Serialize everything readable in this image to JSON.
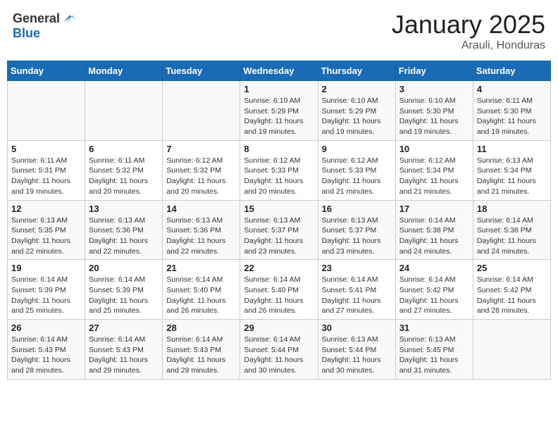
{
  "header": {
    "logo_general": "General",
    "logo_blue": "Blue",
    "month": "January 2025",
    "location": "Arauli, Honduras"
  },
  "weekdays": [
    "Sunday",
    "Monday",
    "Tuesday",
    "Wednesday",
    "Thursday",
    "Friday",
    "Saturday"
  ],
  "weeks": [
    [
      {
        "day": "",
        "sunrise": "",
        "sunset": "",
        "daylight": ""
      },
      {
        "day": "",
        "sunrise": "",
        "sunset": "",
        "daylight": ""
      },
      {
        "day": "",
        "sunrise": "",
        "sunset": "",
        "daylight": ""
      },
      {
        "day": "1",
        "sunrise": "Sunrise: 6:10 AM",
        "sunset": "Sunset: 5:29 PM",
        "daylight": "Daylight: 11 hours and 19 minutes."
      },
      {
        "day": "2",
        "sunrise": "Sunrise: 6:10 AM",
        "sunset": "Sunset: 5:29 PM",
        "daylight": "Daylight: 11 hours and 19 minutes."
      },
      {
        "day": "3",
        "sunrise": "Sunrise: 6:10 AM",
        "sunset": "Sunset: 5:30 PM",
        "daylight": "Daylight: 11 hours and 19 minutes."
      },
      {
        "day": "4",
        "sunrise": "Sunrise: 6:11 AM",
        "sunset": "Sunset: 5:30 PM",
        "daylight": "Daylight: 11 hours and 19 minutes."
      }
    ],
    [
      {
        "day": "5",
        "sunrise": "Sunrise: 6:11 AM",
        "sunset": "Sunset: 5:31 PM",
        "daylight": "Daylight: 11 hours and 19 minutes."
      },
      {
        "day": "6",
        "sunrise": "Sunrise: 6:11 AM",
        "sunset": "Sunset: 5:32 PM",
        "daylight": "Daylight: 11 hours and 20 minutes."
      },
      {
        "day": "7",
        "sunrise": "Sunrise: 6:12 AM",
        "sunset": "Sunset: 5:32 PM",
        "daylight": "Daylight: 11 hours and 20 minutes."
      },
      {
        "day": "8",
        "sunrise": "Sunrise: 6:12 AM",
        "sunset": "Sunset: 5:33 PM",
        "daylight": "Daylight: 11 hours and 20 minutes."
      },
      {
        "day": "9",
        "sunrise": "Sunrise: 6:12 AM",
        "sunset": "Sunset: 5:33 PM",
        "daylight": "Daylight: 11 hours and 21 minutes."
      },
      {
        "day": "10",
        "sunrise": "Sunrise: 6:12 AM",
        "sunset": "Sunset: 5:34 PM",
        "daylight": "Daylight: 11 hours and 21 minutes."
      },
      {
        "day": "11",
        "sunrise": "Sunrise: 6:13 AM",
        "sunset": "Sunset: 5:34 PM",
        "daylight": "Daylight: 11 hours and 21 minutes."
      }
    ],
    [
      {
        "day": "12",
        "sunrise": "Sunrise: 6:13 AM",
        "sunset": "Sunset: 5:35 PM",
        "daylight": "Daylight: 11 hours and 22 minutes."
      },
      {
        "day": "13",
        "sunrise": "Sunrise: 6:13 AM",
        "sunset": "Sunset: 5:36 PM",
        "daylight": "Daylight: 11 hours and 22 minutes."
      },
      {
        "day": "14",
        "sunrise": "Sunrise: 6:13 AM",
        "sunset": "Sunset: 5:36 PM",
        "daylight": "Daylight: 11 hours and 22 minutes."
      },
      {
        "day": "15",
        "sunrise": "Sunrise: 6:13 AM",
        "sunset": "Sunset: 5:37 PM",
        "daylight": "Daylight: 11 hours and 23 minutes."
      },
      {
        "day": "16",
        "sunrise": "Sunrise: 6:13 AM",
        "sunset": "Sunset: 5:37 PM",
        "daylight": "Daylight: 11 hours and 23 minutes."
      },
      {
        "day": "17",
        "sunrise": "Sunrise: 6:14 AM",
        "sunset": "Sunset: 5:38 PM",
        "daylight": "Daylight: 11 hours and 24 minutes."
      },
      {
        "day": "18",
        "sunrise": "Sunrise: 6:14 AM",
        "sunset": "Sunset: 5:38 PM",
        "daylight": "Daylight: 11 hours and 24 minutes."
      }
    ],
    [
      {
        "day": "19",
        "sunrise": "Sunrise: 6:14 AM",
        "sunset": "Sunset: 5:39 PM",
        "daylight": "Daylight: 11 hours and 25 minutes."
      },
      {
        "day": "20",
        "sunrise": "Sunrise: 6:14 AM",
        "sunset": "Sunset: 5:39 PM",
        "daylight": "Daylight: 11 hours and 25 minutes."
      },
      {
        "day": "21",
        "sunrise": "Sunrise: 6:14 AM",
        "sunset": "Sunset: 5:40 PM",
        "daylight": "Daylight: 11 hours and 26 minutes."
      },
      {
        "day": "22",
        "sunrise": "Sunrise: 6:14 AM",
        "sunset": "Sunset: 5:40 PM",
        "daylight": "Daylight: 11 hours and 26 minutes."
      },
      {
        "day": "23",
        "sunrise": "Sunrise: 6:14 AM",
        "sunset": "Sunset: 5:41 PM",
        "daylight": "Daylight: 11 hours and 27 minutes."
      },
      {
        "day": "24",
        "sunrise": "Sunrise: 6:14 AM",
        "sunset": "Sunset: 5:42 PM",
        "daylight": "Daylight: 11 hours and 27 minutes."
      },
      {
        "day": "25",
        "sunrise": "Sunrise: 6:14 AM",
        "sunset": "Sunset: 5:42 PM",
        "daylight": "Daylight: 11 hours and 28 minutes."
      }
    ],
    [
      {
        "day": "26",
        "sunrise": "Sunrise: 6:14 AM",
        "sunset": "Sunset: 5:43 PM",
        "daylight": "Daylight: 11 hours and 28 minutes."
      },
      {
        "day": "27",
        "sunrise": "Sunrise: 6:14 AM",
        "sunset": "Sunset: 5:43 PM",
        "daylight": "Daylight: 11 hours and 29 minutes."
      },
      {
        "day": "28",
        "sunrise": "Sunrise: 6:14 AM",
        "sunset": "Sunset: 5:43 PM",
        "daylight": "Daylight: 11 hours and 29 minutes."
      },
      {
        "day": "29",
        "sunrise": "Sunrise: 6:14 AM",
        "sunset": "Sunset: 5:44 PM",
        "daylight": "Daylight: 11 hours and 30 minutes."
      },
      {
        "day": "30",
        "sunrise": "Sunrise: 6:13 AM",
        "sunset": "Sunset: 5:44 PM",
        "daylight": "Daylight: 11 hours and 30 minutes."
      },
      {
        "day": "31",
        "sunrise": "Sunrise: 6:13 AM",
        "sunset": "Sunset: 5:45 PM",
        "daylight": "Daylight: 11 hours and 31 minutes."
      },
      {
        "day": "",
        "sunrise": "",
        "sunset": "",
        "daylight": ""
      }
    ]
  ]
}
